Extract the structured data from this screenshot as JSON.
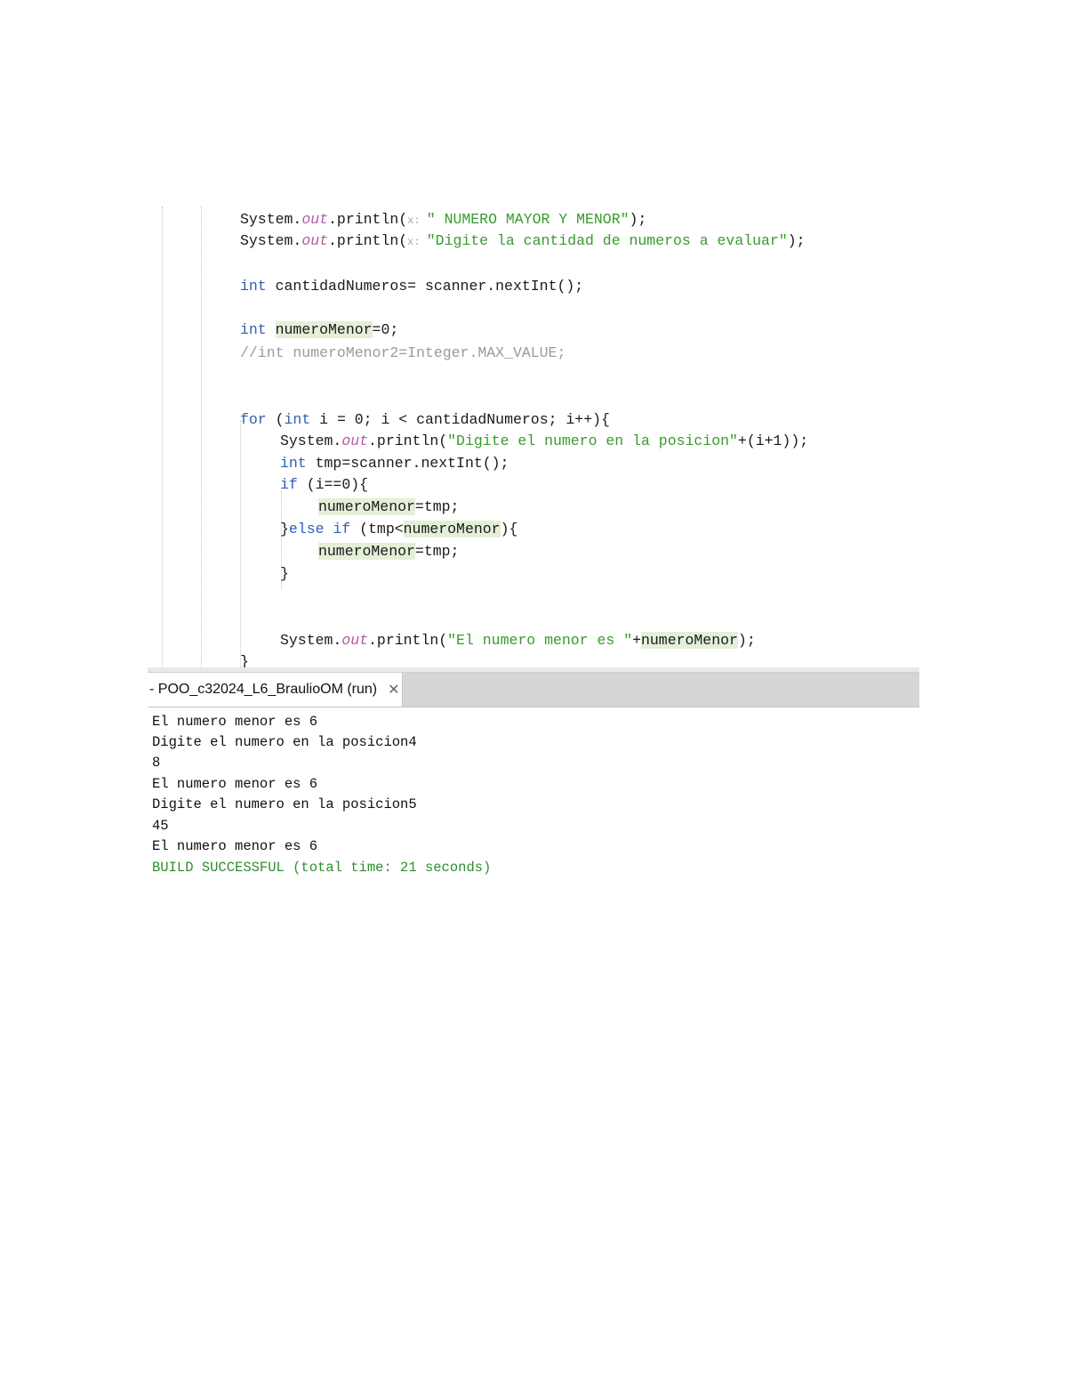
{
  "editor": {
    "lines": [
      {
        "segments": [
          {
            "t": "System.",
            "c": "plain"
          },
          {
            "t": "out",
            "c": "fld"
          },
          {
            "t": ".println(",
            "c": "plain"
          },
          {
            "t": "x: ",
            "c": "hint"
          },
          {
            "t": "\" NUMERO MAYOR Y MENOR\"",
            "c": "str"
          },
          {
            "t": ");",
            "c": "plain"
          }
        ]
      },
      {
        "segments": [
          {
            "t": "System.",
            "c": "plain"
          },
          {
            "t": "out",
            "c": "fld"
          },
          {
            "t": ".println(",
            "c": "plain"
          },
          {
            "t": "x: ",
            "c": "hint"
          },
          {
            "t": "\"Digite la cantidad de numeros a evaluar\"",
            "c": "str"
          },
          {
            "t": ");",
            "c": "plain"
          }
        ]
      },
      {
        "segments": [
          {
            "t": "int",
            "c": "kw"
          },
          {
            "t": " cantidadNumeros= scanner.nextInt();",
            "c": "plain"
          }
        ]
      },
      {
        "segments": [
          {
            "t": "int",
            "c": "kw"
          },
          {
            "t": " ",
            "c": "plain"
          },
          {
            "t": "numeroMenor",
            "c": "hl"
          },
          {
            "t": "=0;",
            "c": "plain"
          }
        ]
      },
      {
        "segments": [
          {
            "t": "//int numeroMenor2=Integer.MAX_VALUE;",
            "c": "cmt"
          }
        ]
      },
      {
        "segments": [
          {
            "t": "for",
            "c": "kw"
          },
          {
            "t": " (",
            "c": "plain"
          },
          {
            "t": "int",
            "c": "kw"
          },
          {
            "t": " i = 0; i < cantidadNumeros; i++){",
            "c": "plain"
          }
        ]
      },
      {
        "segments": [
          {
            "t": "System.",
            "c": "plain"
          },
          {
            "t": "out",
            "c": "fld"
          },
          {
            "t": ".println(",
            "c": "plain"
          },
          {
            "t": "\"Digite el numero en la posicion\"",
            "c": "str"
          },
          {
            "t": "+(i+1));",
            "c": "plain"
          }
        ]
      },
      {
        "segments": [
          {
            "t": "int",
            "c": "kw"
          },
          {
            "t": " tmp=scanner.nextInt();",
            "c": "plain"
          }
        ]
      },
      {
        "segments": [
          {
            "t": "if",
            "c": "kw"
          },
          {
            "t": " (i==0){",
            "c": "plain"
          }
        ]
      },
      {
        "segments": [
          {
            "t": "numeroMenor",
            "c": "hl"
          },
          {
            "t": "=tmp;",
            "c": "plain"
          }
        ]
      },
      {
        "segments": [
          {
            "t": "}",
            "c": "plain"
          },
          {
            "t": "else if",
            "c": "kw"
          },
          {
            "t": " (tmp<",
            "c": "plain"
          },
          {
            "t": "numeroMenor",
            "c": "hl"
          },
          {
            "t": "){",
            "c": "plain"
          }
        ]
      },
      {
        "segments": [
          {
            "t": "numeroMenor",
            "c": "hl"
          },
          {
            "t": "=tmp;",
            "c": "plain"
          }
        ]
      },
      {
        "segments": [
          {
            "t": "}",
            "c": "plain"
          }
        ]
      },
      {
        "segments": [
          {
            "t": "System.",
            "c": "plain"
          },
          {
            "t": "out",
            "c": "fld"
          },
          {
            "t": ".println(",
            "c": "plain"
          },
          {
            "t": "\"El numero menor es \"",
            "c": "str"
          },
          {
            "t": "+",
            "c": "plain"
          },
          {
            "t": "numeroMenor",
            "c": "hl"
          },
          {
            "t": ");",
            "c": "plain"
          }
        ]
      },
      {
        "segments": [
          {
            "t": "}",
            "c": "plain"
          }
        ]
      }
    ]
  },
  "output_tab": {
    "label": "- POO_c32024_L6_BraulioOM (run)",
    "close_glyph": "✕"
  },
  "console": {
    "lines": [
      "El numero menor es 6",
      "Digite el numero en la posicion4",
      "8",
      "El numero menor es 6",
      "Digite el numero en la posicion5",
      "45",
      "El numero menor es 6"
    ],
    "build_status": "BUILD SUCCESSFUL (total time: 21 seconds)"
  },
  "colors": {
    "keyword": "#2f5fb3",
    "field": "#b35aa4",
    "string": "#3a9a2e",
    "comment": "#9a9a9a",
    "highlight": "#e4efd8",
    "build_success": "#2f8f2f"
  }
}
